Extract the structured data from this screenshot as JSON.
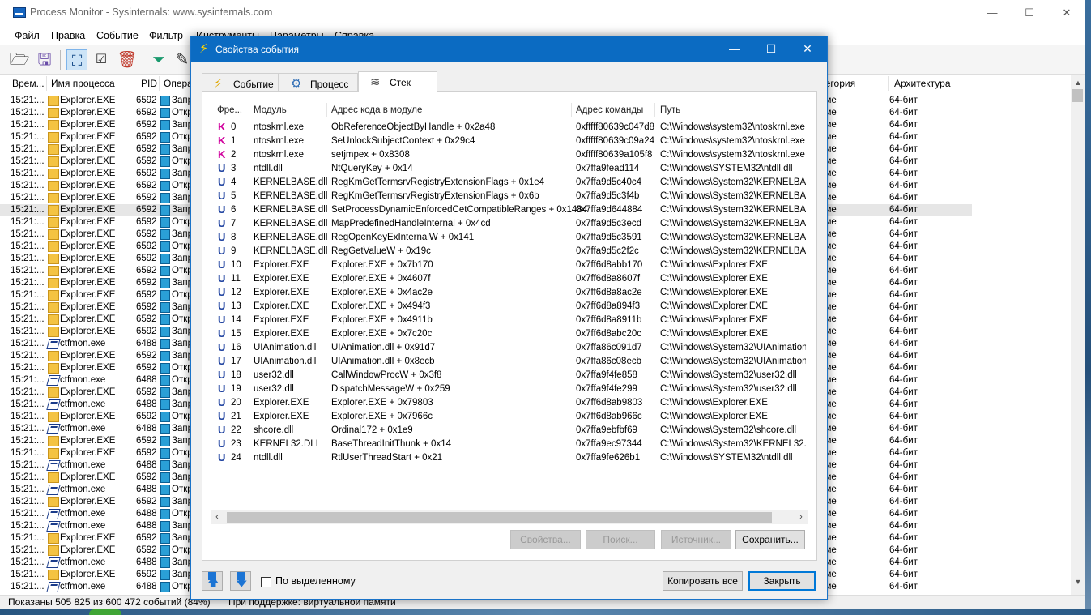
{
  "window": {
    "title": "Process Monitor - Sysinternals: www.sysinternals.com",
    "minimize": "—",
    "maximize": "☐",
    "close": "✕"
  },
  "menu": [
    "Файл",
    "Правка",
    "Событие",
    "Фильтр",
    "Инструменты",
    "Параметры",
    "Справка"
  ],
  "toolbar": {
    "icons": [
      "open-folder-icon",
      "save-icon",
      "capture-icon",
      "autoscroll-icon",
      "clear-icon",
      "filter-icon",
      "highlight-icon"
    ]
  },
  "columns": {
    "time": "Врем...",
    "process": "Имя процесса",
    "pid": "PID",
    "operation": "Опера",
    "category": "Категория",
    "arch": "Архитектура"
  },
  "rows": [
    {
      "time": "15:21:...",
      "process": "Explorer.EXE",
      "pid": "6592",
      "op": "Запр",
      "cat": "ие",
      "arch": "64-бит",
      "icon": "exp"
    },
    {
      "time": "15:21:...",
      "process": "Explorer.EXE",
      "pid": "6592",
      "op": "Откр",
      "cat": "ие",
      "arch": "64-бит",
      "icon": "exp"
    },
    {
      "time": "15:21:...",
      "process": "Explorer.EXE",
      "pid": "6592",
      "op": "Запр",
      "cat": "ие",
      "arch": "64-бит",
      "icon": "exp"
    },
    {
      "time": "15:21:...",
      "process": "Explorer.EXE",
      "pid": "6592",
      "op": "Откр",
      "cat": "ие",
      "arch": "64-бит",
      "icon": "exp"
    },
    {
      "time": "15:21:...",
      "process": "Explorer.EXE",
      "pid": "6592",
      "op": "Запр",
      "cat": "ие",
      "arch": "64-бит",
      "icon": "exp"
    },
    {
      "time": "15:21:...",
      "process": "Explorer.EXE",
      "pid": "6592",
      "op": "Откр",
      "cat": "ие",
      "arch": "64-бит",
      "icon": "exp"
    },
    {
      "time": "15:21:...",
      "process": "Explorer.EXE",
      "pid": "6592",
      "op": "Запр",
      "cat": "ие",
      "arch": "64-бит",
      "icon": "exp"
    },
    {
      "time": "15:21:...",
      "process": "Explorer.EXE",
      "pid": "6592",
      "op": "Откр",
      "cat": "ие",
      "arch": "64-бит",
      "icon": "exp"
    },
    {
      "time": "15:21:...",
      "process": "Explorer.EXE",
      "pid": "6592",
      "op": "Запр",
      "cat": "ие",
      "arch": "64-бит",
      "icon": "exp"
    },
    {
      "time": "15:21:...",
      "process": "Explorer.EXE",
      "pid": "6592",
      "op": "Запр",
      "cat": "ие",
      "arch": "64-бит",
      "icon": "exp",
      "selected": true
    },
    {
      "time": "15:21:...",
      "process": "Explorer.EXE",
      "pid": "6592",
      "op": "Откр",
      "cat": "ие",
      "arch": "64-бит",
      "icon": "exp"
    },
    {
      "time": "15:21:...",
      "process": "Explorer.EXE",
      "pid": "6592",
      "op": "Запр",
      "cat": "ие",
      "arch": "64-бит",
      "icon": "exp"
    },
    {
      "time": "15:21:...",
      "process": "Explorer.EXE",
      "pid": "6592",
      "op": "Откр",
      "cat": "ие",
      "arch": "64-бит",
      "icon": "exp"
    },
    {
      "time": "15:21:...",
      "process": "Explorer.EXE",
      "pid": "6592",
      "op": "Запр",
      "cat": "ие",
      "arch": "64-бит",
      "icon": "exp"
    },
    {
      "time": "15:21:...",
      "process": "Explorer.EXE",
      "pid": "6592",
      "op": "Откр",
      "cat": "ие",
      "arch": "64-бит",
      "icon": "exp"
    },
    {
      "time": "15:21:...",
      "process": "Explorer.EXE",
      "pid": "6592",
      "op": "Запр",
      "cat": "ие",
      "arch": "64-бит",
      "icon": "exp"
    },
    {
      "time": "15:21:...",
      "process": "Explorer.EXE",
      "pid": "6592",
      "op": "Откр",
      "cat": "ие",
      "arch": "64-бит",
      "icon": "exp"
    },
    {
      "time": "15:21:...",
      "process": "Explorer.EXE",
      "pid": "6592",
      "op": "Запр",
      "cat": "ие",
      "arch": "64-бит",
      "icon": "exp"
    },
    {
      "time": "15:21:...",
      "process": "Explorer.EXE",
      "pid": "6592",
      "op": "Откр",
      "cat": "ие",
      "arch": "64-бит",
      "icon": "exp"
    },
    {
      "time": "15:21:...",
      "process": "Explorer.EXE",
      "pid": "6592",
      "op": "Запр",
      "cat": "ие",
      "arch": "64-бит",
      "icon": "exp"
    },
    {
      "time": "15:21:...",
      "process": "ctfmon.exe",
      "pid": "6488",
      "op": "Запр",
      "cat": "ие",
      "arch": "64-бит",
      "icon": "ctf"
    },
    {
      "time": "15:21:...",
      "process": "Explorer.EXE",
      "pid": "6592",
      "op": "Запр",
      "cat": "ие",
      "arch": "64-бит",
      "icon": "exp"
    },
    {
      "time": "15:21:...",
      "process": "Explorer.EXE",
      "pid": "6592",
      "op": "Откр",
      "cat": "ие",
      "arch": "64-бит",
      "icon": "exp"
    },
    {
      "time": "15:21:...",
      "process": "ctfmon.exe",
      "pid": "6488",
      "op": "Откр",
      "cat": "ие",
      "arch": "64-бит",
      "icon": "ctf"
    },
    {
      "time": "15:21:...",
      "process": "Explorer.EXE",
      "pid": "6592",
      "op": "Запр",
      "cat": "ие",
      "arch": "64-бит",
      "icon": "exp"
    },
    {
      "time": "15:21:...",
      "process": "ctfmon.exe",
      "pid": "6488",
      "op": "Запр",
      "cat": "ие",
      "arch": "64-бит",
      "icon": "ctf"
    },
    {
      "time": "15:21:...",
      "process": "Explorer.EXE",
      "pid": "6592",
      "op": "Откр",
      "cat": "ие",
      "arch": "64-бит",
      "icon": "exp"
    },
    {
      "time": "15:21:...",
      "process": "ctfmon.exe",
      "pid": "6488",
      "op": "Запр",
      "cat": "ие",
      "arch": "64-бит",
      "icon": "ctf"
    },
    {
      "time": "15:21:...",
      "process": "Explorer.EXE",
      "pid": "6592",
      "op": "Запр",
      "cat": "ие",
      "arch": "64-бит",
      "icon": "exp"
    },
    {
      "time": "15:21:...",
      "process": "Explorer.EXE",
      "pid": "6592",
      "op": "Откр",
      "cat": "ие",
      "arch": "64-бит",
      "icon": "exp"
    },
    {
      "time": "15:21:...",
      "process": "ctfmon.exe",
      "pid": "6488",
      "op": "Запр",
      "cat": "ие",
      "arch": "64-бит",
      "icon": "ctf"
    },
    {
      "time": "15:21:...",
      "process": "Explorer.EXE",
      "pid": "6592",
      "op": "Запр",
      "cat": "ие",
      "arch": "64-бит",
      "icon": "exp"
    },
    {
      "time": "15:21:...",
      "process": "ctfmon.exe",
      "pid": "6488",
      "op": "Откр",
      "cat": "ие",
      "arch": "64-бит",
      "icon": "ctf"
    },
    {
      "time": "15:21:...",
      "process": "Explorer.EXE",
      "pid": "6592",
      "op": "Запр",
      "cat": "ие",
      "arch": "64-бит",
      "icon": "exp"
    },
    {
      "time": "15:21:...",
      "process": "ctfmon.exe",
      "pid": "6488",
      "op": "Откр",
      "cat": "ие",
      "arch": "64-бит",
      "icon": "ctf"
    },
    {
      "time": "15:21:...",
      "process": "ctfmon.exe",
      "pid": "6488",
      "op": "Запр",
      "cat": "ие",
      "arch": "64-бит",
      "icon": "ctf"
    },
    {
      "time": "15:21:...",
      "process": "Explorer.EXE",
      "pid": "6592",
      "op": "Запр",
      "cat": "ие",
      "arch": "64-бит",
      "icon": "exp"
    },
    {
      "time": "15:21:...",
      "process": "Explorer.EXE",
      "pid": "6592",
      "op": "Откр",
      "cat": "ие",
      "arch": "64-бит",
      "icon": "exp"
    },
    {
      "time": "15:21:...",
      "process": "ctfmon.exe",
      "pid": "6488",
      "op": "Запр",
      "cat": "ие",
      "arch": "64-бит",
      "icon": "ctf"
    },
    {
      "time": "15:21:...",
      "process": "Explorer.EXE",
      "pid": "6592",
      "op": "Запр",
      "cat": "ие",
      "arch": "64-бит",
      "icon": "exp"
    },
    {
      "time": "15:21:...",
      "process": "ctfmon.exe",
      "pid": "6488",
      "op": "Откр",
      "cat": "ие",
      "arch": "64-бит",
      "icon": "ctf"
    }
  ],
  "status": {
    "left": "Показаны 505 825 из 600 472 событий (84%)",
    "right": "При поддержке: виртуальной памяти"
  },
  "dialog": {
    "title": "Свойства события",
    "minimize": "—",
    "maximize": "☐",
    "close": "✕",
    "tabs": [
      {
        "label": "Событие",
        "icon": "lightning-icon",
        "glyph": "⚡"
      },
      {
        "label": "Процесс",
        "icon": "gear-icon",
        "glyph": "⚙"
      },
      {
        "label": "Стек",
        "icon": "stack-icon",
        "glyph": "≋"
      }
    ],
    "active_tab": 2,
    "stack_columns": {
      "frame": "Фре...",
      "module": "Модуль",
      "location": "Адрес кода в модуле",
      "address": "Адрес команды",
      "path": "Путь"
    },
    "frames": [
      {
        "kind": "K",
        "n": "0",
        "module": "ntoskrnl.exe",
        "location": "ObReferenceObjectByHandle + 0x2a48",
        "address": "0xfffff80639c047d8",
        "path": "C:\\Windows\\system32\\ntoskrnl.exe"
      },
      {
        "kind": "K",
        "n": "1",
        "module": "ntoskrnl.exe",
        "location": "SeUnlockSubjectContext + 0x29c4",
        "address": "0xfffff80639c09a24",
        "path": "C:\\Windows\\system32\\ntoskrnl.exe"
      },
      {
        "kind": "K",
        "n": "2",
        "module": "ntoskrnl.exe",
        "location": "setjmpex + 0x8308",
        "address": "0xfffff80639a105f8",
        "path": "C:\\Windows\\system32\\ntoskrnl.exe"
      },
      {
        "kind": "U",
        "n": "3",
        "module": "ntdll.dll",
        "location": "NtQueryKey + 0x14",
        "address": "0x7ffa9fead114",
        "path": "C:\\Windows\\SYSTEM32\\ntdll.dll"
      },
      {
        "kind": "U",
        "n": "4",
        "module": "KERNELBASE.dll",
        "location": "RegKmGetTermsrvRegistryExtensionFlags + 0x1e4",
        "address": "0x7ffa9d5c40c4",
        "path": "C:\\Windows\\System32\\KERNELBAS"
      },
      {
        "kind": "U",
        "n": "5",
        "module": "KERNELBASE.dll",
        "location": "RegKmGetTermsrvRegistryExtensionFlags + 0x6b",
        "address": "0x7ffa9d5c3f4b",
        "path": "C:\\Windows\\System32\\KERNELBAS"
      },
      {
        "kind": "U",
        "n": "6",
        "module": "KERNELBASE.dll",
        "location": "SetProcessDynamicEnforcedCetCompatibleRanges + 0x1484",
        "address": "0x7ffa9d644884",
        "path": "C:\\Windows\\System32\\KERNELBAS"
      },
      {
        "kind": "U",
        "n": "7",
        "module": "KERNELBASE.dll",
        "location": "MapPredefinedHandleInternal + 0x4cd",
        "address": "0x7ffa9d5c3ecd",
        "path": "C:\\Windows\\System32\\KERNELBAS"
      },
      {
        "kind": "U",
        "n": "8",
        "module": "KERNELBASE.dll",
        "location": "RegOpenKeyExInternalW + 0x141",
        "address": "0x7ffa9d5c3591",
        "path": "C:\\Windows\\System32\\KERNELBAS"
      },
      {
        "kind": "U",
        "n": "9",
        "module": "KERNELBASE.dll",
        "location": "RegGetValueW + 0x19c",
        "address": "0x7ffa9d5c2f2c",
        "path": "C:\\Windows\\System32\\KERNELBAS"
      },
      {
        "kind": "U",
        "n": "10",
        "module": "Explorer.EXE",
        "location": "Explorer.EXE + 0x7b170",
        "address": "0x7ff6d8abb170",
        "path": "C:\\Windows\\Explorer.EXE"
      },
      {
        "kind": "U",
        "n": "11",
        "module": "Explorer.EXE",
        "location": "Explorer.EXE + 0x4607f",
        "address": "0x7ff6d8a8607f",
        "path": "C:\\Windows\\Explorer.EXE"
      },
      {
        "kind": "U",
        "n": "12",
        "module": "Explorer.EXE",
        "location": "Explorer.EXE + 0x4ac2e",
        "address": "0x7ff6d8a8ac2e",
        "path": "C:\\Windows\\Explorer.EXE"
      },
      {
        "kind": "U",
        "n": "13",
        "module": "Explorer.EXE",
        "location": "Explorer.EXE + 0x494f3",
        "address": "0x7ff6d8a894f3",
        "path": "C:\\Windows\\Explorer.EXE"
      },
      {
        "kind": "U",
        "n": "14",
        "module": "Explorer.EXE",
        "location": "Explorer.EXE + 0x4911b",
        "address": "0x7ff6d8a8911b",
        "path": "C:\\Windows\\Explorer.EXE"
      },
      {
        "kind": "U",
        "n": "15",
        "module": "Explorer.EXE",
        "location": "Explorer.EXE + 0x7c20c",
        "address": "0x7ff6d8abc20c",
        "path": "C:\\Windows\\Explorer.EXE"
      },
      {
        "kind": "U",
        "n": "16",
        "module": "UIAnimation.dll",
        "location": "UIAnimation.dll + 0x91d7",
        "address": "0x7ffa86c091d7",
        "path": "C:\\Windows\\System32\\UIAnimation.c"
      },
      {
        "kind": "U",
        "n": "17",
        "module": "UIAnimation.dll",
        "location": "UIAnimation.dll + 0x8ecb",
        "address": "0x7ffa86c08ecb",
        "path": "C:\\Windows\\System32\\UIAnimation.c"
      },
      {
        "kind": "U",
        "n": "18",
        "module": "user32.dll",
        "location": "CallWindowProcW + 0x3f8",
        "address": "0x7ffa9f4fe858",
        "path": "C:\\Windows\\System32\\user32.dll"
      },
      {
        "kind": "U",
        "n": "19",
        "module": "user32.dll",
        "location": "DispatchMessageW + 0x259",
        "address": "0x7ffa9f4fe299",
        "path": "C:\\Windows\\System32\\user32.dll"
      },
      {
        "kind": "U",
        "n": "20",
        "module": "Explorer.EXE",
        "location": "Explorer.EXE + 0x79803",
        "address": "0x7ff6d8ab9803",
        "path": "C:\\Windows\\Explorer.EXE"
      },
      {
        "kind": "U",
        "n": "21",
        "module": "Explorer.EXE",
        "location": "Explorer.EXE + 0x7966c",
        "address": "0x7ff6d8ab966c",
        "path": "C:\\Windows\\Explorer.EXE"
      },
      {
        "kind": "U",
        "n": "22",
        "module": "shcore.dll",
        "location": "Ordinal172 + 0x1e9",
        "address": "0x7ffa9ebfbf69",
        "path": "C:\\Windows\\System32\\shcore.dll"
      },
      {
        "kind": "U",
        "n": "23",
        "module": "KERNEL32.DLL",
        "location": "BaseThreadInitThunk + 0x14",
        "address": "0x7ffa9ec97344",
        "path": "C:\\Windows\\System32\\KERNEL32.D"
      },
      {
        "kind": "U",
        "n": "24",
        "module": "ntdll.dll",
        "location": "RtlUserThreadStart + 0x21",
        "address": "0x7ffa9fe626b1",
        "path": "C:\\Windows\\SYSTEM32\\ntdll.dll"
      }
    ],
    "buttons": {
      "properties": "Свойства...",
      "search": "Поиск...",
      "source": "Источник...",
      "save": "Сохранить..."
    },
    "selected_only_label": "По выделенному",
    "selected_only_checked": false,
    "copy_all": "Копировать все",
    "close_btn": "Закрыть"
  }
}
